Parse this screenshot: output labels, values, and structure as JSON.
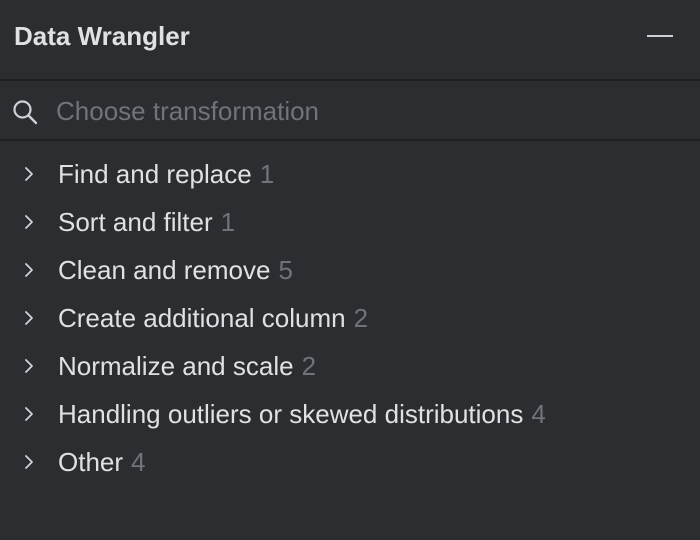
{
  "header": {
    "title": "Data Wrangler",
    "minimize_icon": "minimize-icon"
  },
  "search": {
    "placeholder": "Choose transformation",
    "value": "",
    "icon": "search-icon"
  },
  "colors": {
    "background": "#2b2d30",
    "divider": "#1e1f22",
    "text": "#dfe1e5",
    "muted": "#6f737a"
  },
  "categories": [
    {
      "label": "Find and replace",
      "count": "1",
      "icon": "chevron-right-icon"
    },
    {
      "label": "Sort and filter",
      "count": "1",
      "icon": "chevron-right-icon"
    },
    {
      "label": "Clean and remove",
      "count": "5",
      "icon": "chevron-right-icon"
    },
    {
      "label": "Create additional column",
      "count": "2",
      "icon": "chevron-right-icon"
    },
    {
      "label": "Normalize and scale",
      "count": "2",
      "icon": "chevron-right-icon"
    },
    {
      "label": "Handling outliers or skewed distributions",
      "count": "4",
      "icon": "chevron-right-icon"
    },
    {
      "label": "Other",
      "count": "4",
      "icon": "chevron-right-icon"
    }
  ]
}
